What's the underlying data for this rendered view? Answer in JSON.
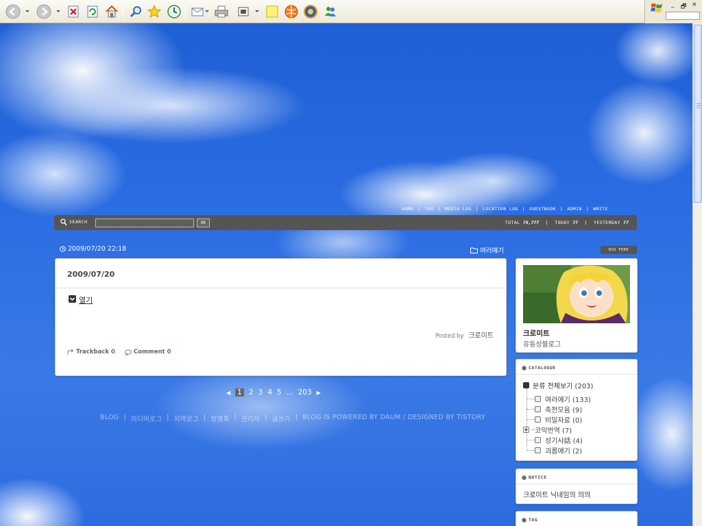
{
  "browser": {
    "toolbar_icons": [
      "back-icon",
      "forward-icon",
      "stop-icon",
      "refresh-icon",
      "home-icon",
      "search-icon",
      "favorites-icon",
      "history-icon",
      "mail-icon",
      "print-icon",
      "edit-icon",
      "note-icon",
      "media-icon",
      "messenger-icon",
      "buddy-icon"
    ],
    "window_controls": [
      "_",
      "🗗",
      "×"
    ]
  },
  "blog": {
    "topnav": [
      "HOME",
      "TAG",
      "MEDIA LOG",
      "LOCATION LOG",
      "GUESTBOOK",
      "ADMIN",
      "WRITE"
    ],
    "search": {
      "label": "SEARCH",
      "value": "",
      "ok_label": "OK"
    },
    "counters": {
      "total_label": "TOTAL",
      "total": "78,777",
      "today_label": "TODAY",
      "today": "77",
      "yesterday_label": "YESTERDAY",
      "yesterday": "77"
    },
    "post": {
      "datetime": "2009/07/20 22:18",
      "category": "여러얘기",
      "title": "2009/07/20",
      "more_label": "열기",
      "posted_by_label": "Posted by",
      "author": "크로미트",
      "trackback_label": "Trackback",
      "trackback_count": "0",
      "comment_label": "Comment",
      "comment_count": "0"
    },
    "rss_label": "RSS FEED",
    "pagination": {
      "prev": "◀",
      "current": "1",
      "pages": [
        "2",
        "3",
        "4",
        "5"
      ],
      "ellipsis": "...",
      "last": "203",
      "next": "▶"
    },
    "footer": [
      "BLOG",
      "미디어로그",
      "지역로그",
      "방명록",
      "관리자",
      "글쓰기",
      "BLOG IS POWERED BY DAUM / DESIGNED BY TISTORY"
    ]
  },
  "sidebar": {
    "profile": {
      "name": "크로미트",
      "desc": "유동성블로그"
    },
    "catalogue": {
      "title": "CATALOGUE",
      "root": "분류 전체보기 (203)",
      "items": [
        {
          "label": "여러얘기 (133)",
          "expandable": false
        },
        {
          "label": "축전모음 (9)",
          "expandable": false
        },
        {
          "label": "비밀자료 (0)",
          "expandable": false
        },
        {
          "label": "코믹번역 (7)",
          "expandable": true
        },
        {
          "label": "성기사話 (4)",
          "expandable": false
        },
        {
          "label": "괴롭얘기 (2)",
          "expandable": false
        }
      ]
    },
    "notice": {
      "title": "NOTICE",
      "text": "크로미트 닉네임의 의의"
    },
    "tag": {
      "title": "TAG"
    }
  }
}
